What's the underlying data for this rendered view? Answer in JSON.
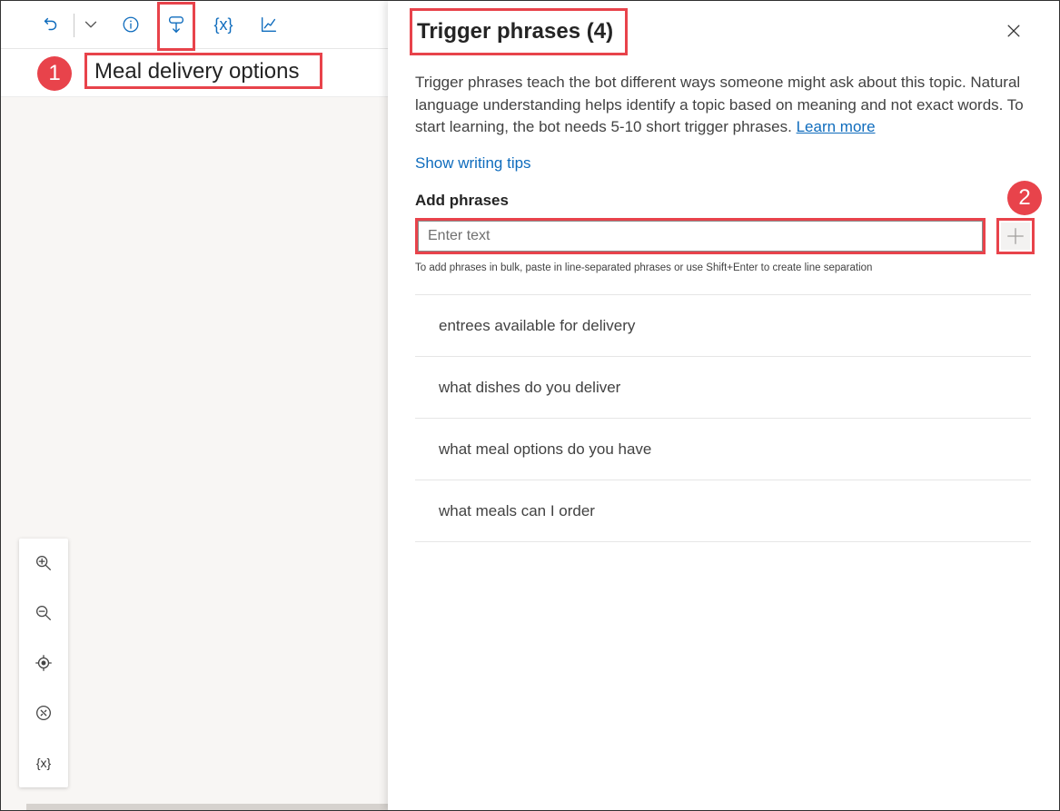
{
  "canvas": {
    "toolbar": {
      "undo_icon": "undo-icon",
      "undo_dropdown_icon": "chevron-down-icon",
      "info_icon": "info-icon",
      "trigger_icon": "trigger-phrases-icon",
      "variables_label": "{x}",
      "analytics_icon": "chart-icon"
    },
    "topic_title": "Meal delivery options",
    "callout_1": "1",
    "zoom": {
      "zoom_in_icon": "zoom-in-icon",
      "zoom_out_icon": "zoom-out-icon",
      "recenter_icon": "recenter-icon",
      "minimap_icon": "compass-icon",
      "variables_label": "{x}"
    }
  },
  "panel": {
    "title": "Trigger phrases (4)",
    "close_icon": "close-icon",
    "description": "Trigger phrases teach the bot different ways someone might ask about this topic. Natural language understanding helps identify a topic based on meaning and not exact words. To start learning, the bot needs 5-10 short trigger phrases.",
    "learn_more": "Learn more",
    "show_tips": "Show writing tips",
    "add_label": "Add phrases",
    "input": {
      "placeholder": "Enter text",
      "value": ""
    },
    "add_button_icon": "plus-icon",
    "callout_2": "2",
    "hint": "To add phrases in bulk, paste in line-separated phrases or use Shift+Enter to create line separation",
    "phrases": [
      "entrees available for delivery",
      "what dishes do you deliver",
      "what meal options do you have",
      "what meals can I order"
    ]
  },
  "colors": {
    "accent": "#0f6cbd",
    "highlight": "#e8434b",
    "canvas_bg": "#f8f6f4"
  }
}
